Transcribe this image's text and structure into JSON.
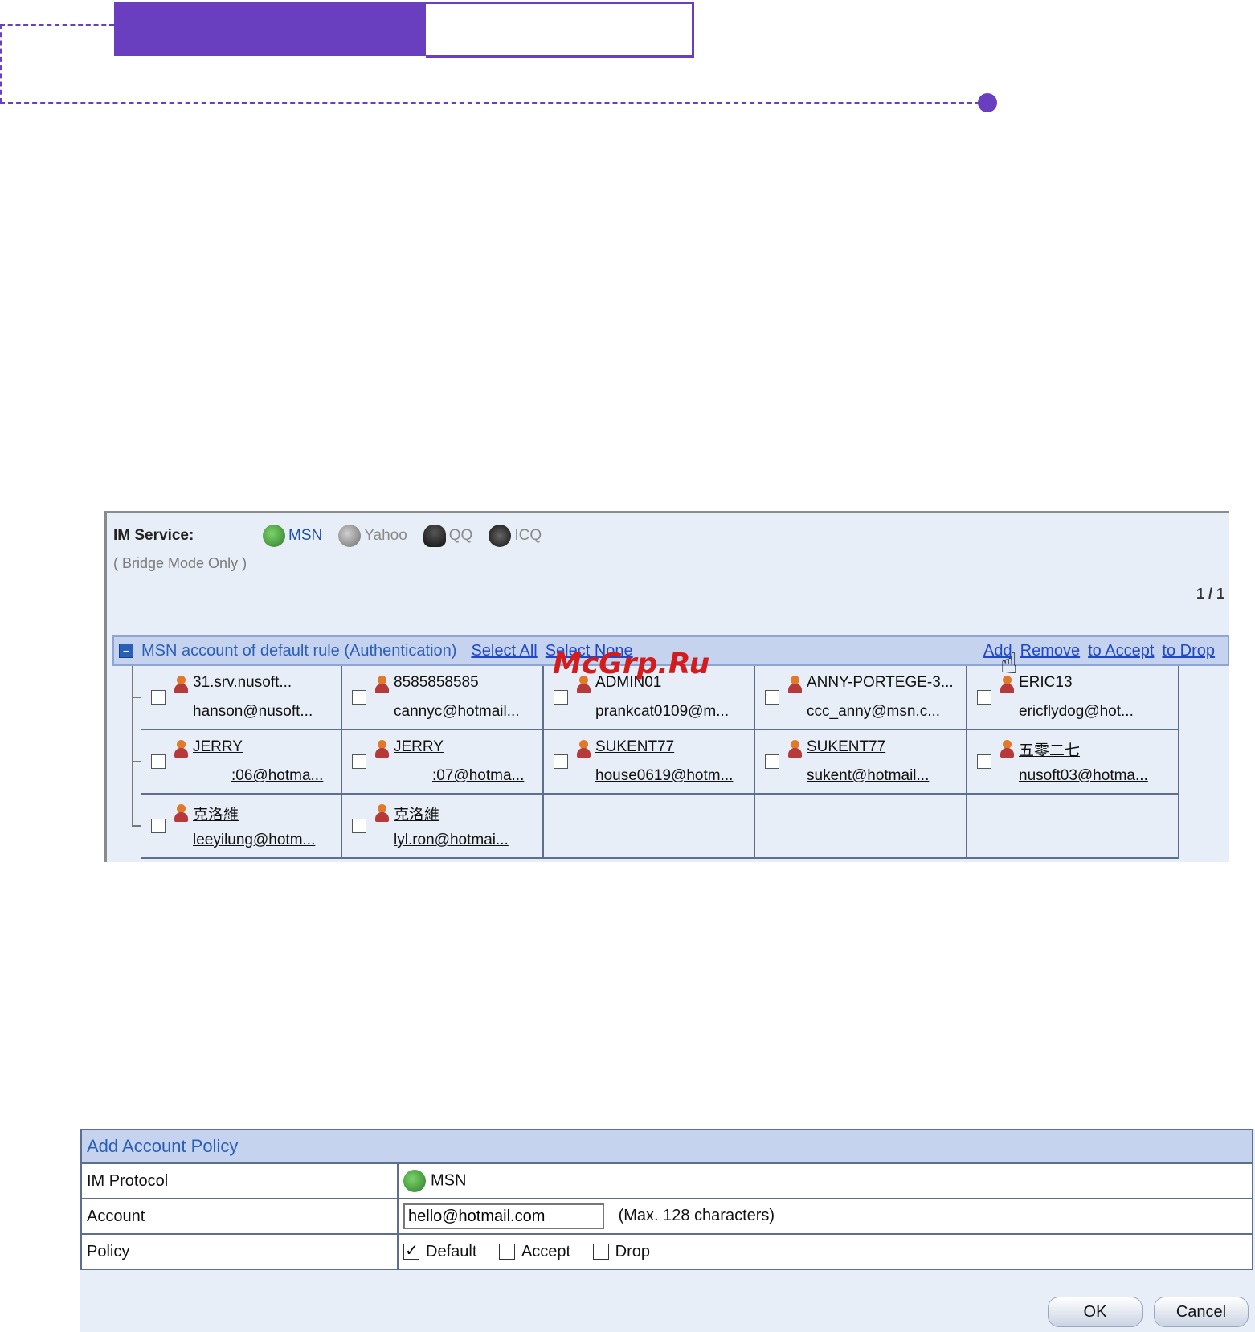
{
  "panel1": {
    "im_service_label": "IM Service:",
    "services": [
      {
        "name": "MSN",
        "icon": "msn-icon"
      },
      {
        "name": "Yahoo",
        "icon": "yahoo-icon"
      },
      {
        "name": "QQ",
        "icon": "qq-icon"
      },
      {
        "name": "ICQ",
        "icon": "icq-icon"
      }
    ],
    "bridge_note": "( Bridge Mode Only )",
    "pager": "1 / 1",
    "account_header": {
      "title": "MSN account of default rule (Authentication)",
      "select_all": "Select All",
      "select_none": "Select None",
      "add": "Add",
      "remove": "Remove",
      "to_accept": "to Accept",
      "to_drop": "to Drop"
    },
    "accounts": [
      {
        "name": "31.srv.nusoft...",
        "email": "hanson@nusoft..."
      },
      {
        "name": "8585858585",
        "email": "cannyc@hotmail..."
      },
      {
        "name": "ADMIN01",
        "email": "prankcat0109@m..."
      },
      {
        "name": "ANNY-PORTEGE-3...",
        "email": "ccc_anny@msn.c..."
      },
      {
        "name": "ERIC13",
        "email": "ericflydog@hot..."
      },
      {
        "name": "JERRY",
        "email": ":06@hotma..."
      },
      {
        "name": "JERRY",
        "email": ":07@hotma..."
      },
      {
        "name": "SUKENT77",
        "email": "house0619@hotm..."
      },
      {
        "name": "SUKENT77",
        "email": "sukent@hotmail..."
      },
      {
        "name": "五零二七",
        "email": "nusoft03@hotma..."
      },
      {
        "name": "克洛維",
        "email": "leeyilung@hotm..."
      },
      {
        "name": "克洛維",
        "email": "lyl.ron@hotmai..."
      }
    ],
    "watermark": "McGrp.Ru"
  },
  "panel2": {
    "title": "Add Account Policy",
    "im_protocol_label": "IM Protocol",
    "im_protocol_value": "MSN",
    "account_label": "Account",
    "account_value": "hello@hotmail.com",
    "account_hint": "(Max. 128 characters)",
    "policy_label": "Policy",
    "policy_options": [
      {
        "label": "Default",
        "checked": true
      },
      {
        "label": "Accept",
        "checked": false
      },
      {
        "label": "Drop",
        "checked": false
      }
    ],
    "ok": "OK",
    "cancel": "Cancel"
  },
  "colors": {
    "brand_purple": "#6a3fbf",
    "header_blue": "#c5d3ee",
    "link_blue": "#1f47c8"
  }
}
